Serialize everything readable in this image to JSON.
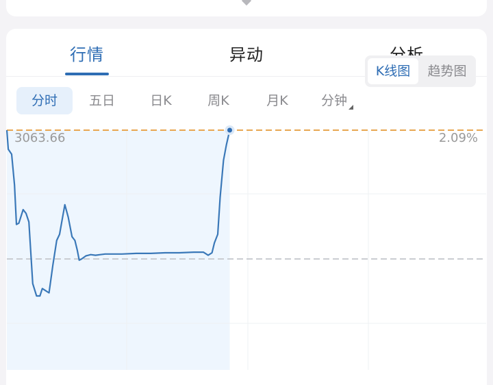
{
  "tabs": [
    {
      "label": "行情",
      "active": true
    },
    {
      "label": "异动",
      "active": false
    },
    {
      "label": "分析",
      "active": false
    }
  ],
  "periods": [
    {
      "label": "分时",
      "active": true
    },
    {
      "label": "五日",
      "active": false
    },
    {
      "label": "日K",
      "active": false
    },
    {
      "label": "周K",
      "active": false
    },
    {
      "label": "月K",
      "active": false
    },
    {
      "label": "分钟",
      "active": false,
      "has_dropdown": true
    }
  ],
  "chart_mode": {
    "options": [
      "K线图",
      "趋势图"
    ],
    "selected": "K线图"
  },
  "colors": {
    "accent": "#2e6db4",
    "line": "#3a78b8",
    "area_fill": "#eef6fe",
    "top_ref_line": "#e8a650",
    "mid_ref_line": "#c9ccd1",
    "text_muted": "#999999"
  },
  "chart_data": {
    "type": "line",
    "title": "",
    "left_axis_label": "3063.66",
    "right_axis_label": "2.09%",
    "y_top_price": 3063.66,
    "y_top_pct": 2.09,
    "y_mid_pct": 0,
    "session_progress": 0.465,
    "ylim_pct": [
      -2.09,
      2.09
    ],
    "series": [
      {
        "name": "intraday",
        "x_fraction": [
          0.0,
          0.003,
          0.01,
          0.016,
          0.02,
          0.025,
          0.034,
          0.04,
          0.046,
          0.054,
          0.062,
          0.069,
          0.074,
          0.082,
          0.088,
          0.096,
          0.104,
          0.11,
          0.115,
          0.121,
          0.128,
          0.136,
          0.142,
          0.147,
          0.151,
          0.156,
          0.165,
          0.175,
          0.185,
          0.195,
          0.205,
          0.22,
          0.24,
          0.27,
          0.3,
          0.33,
          0.36,
          0.39,
          0.41,
          0.42,
          0.428,
          0.433,
          0.44,
          0.445,
          0.452,
          0.458,
          0.465
        ],
        "pct": [
          2.09,
          1.78,
          1.7,
          1.2,
          0.56,
          0.58,
          0.8,
          0.74,
          0.6,
          -0.4,
          -0.6,
          -0.6,
          -0.48,
          -0.52,
          -0.55,
          -0.1,
          0.3,
          0.4,
          0.62,
          0.88,
          0.68,
          0.36,
          0.3,
          0.14,
          -0.02,
          0.0,
          0.05,
          0.07,
          0.06,
          0.07,
          0.08,
          0.08,
          0.08,
          0.09,
          0.09,
          0.1,
          0.1,
          0.11,
          0.11,
          0.06,
          0.1,
          0.26,
          0.4,
          1.0,
          1.6,
          1.85,
          2.09
        ]
      }
    ],
    "grid": true
  }
}
